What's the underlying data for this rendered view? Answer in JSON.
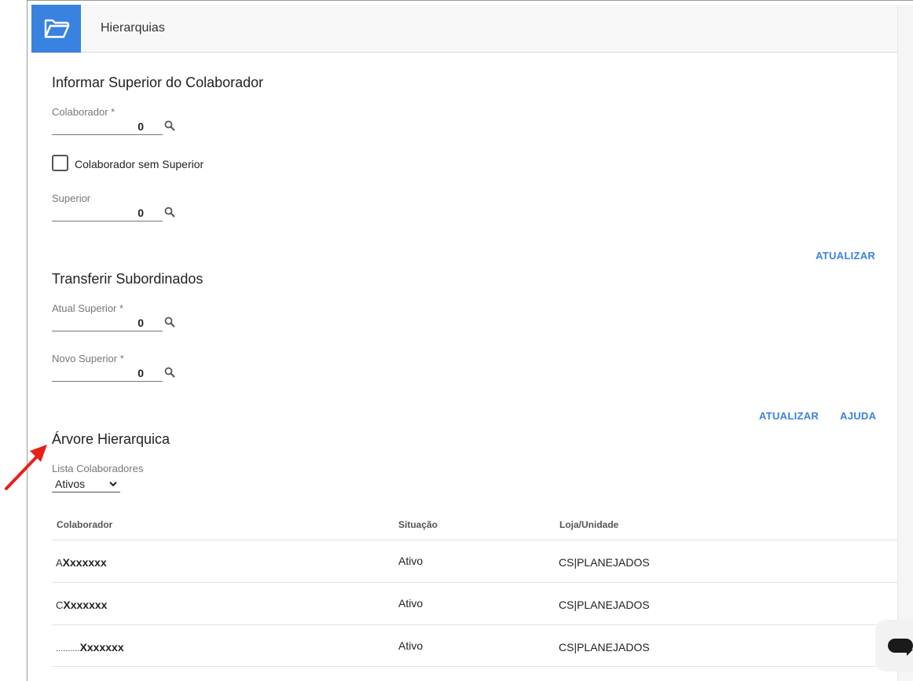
{
  "header": {
    "title": "Hierarquias",
    "icon": "folder-open-icon"
  },
  "section1": {
    "title": "Informar Superior do Colaborador",
    "colaborador": {
      "label": "Colaborador *",
      "value": "0"
    },
    "sem_superior_label": "Colaborador sem Superior",
    "superior": {
      "label": "Superior",
      "value": "0"
    },
    "update_label": "ATUALIZAR"
  },
  "section2": {
    "title": "Transferir Subordinados",
    "atual": {
      "label": "Atual Superior *",
      "value": "0"
    },
    "novo": {
      "label": "Novo Superior *",
      "value": "0"
    },
    "update_label": "ATUALIZAR",
    "help_label": "AJUDA"
  },
  "section3": {
    "title": "Árvore Hierarquica",
    "list_label": "Lista Colaboradores",
    "list_value": "Ativos",
    "columns": [
      "Colaborador",
      "Situação",
      "Loja/Unidade"
    ],
    "rows": [
      {
        "prefix": "A",
        "name": "Xxxxxxx",
        "status": "Ativo",
        "unit": "CS|PLANEJADOS"
      },
      {
        "prefix": "C",
        "name": "Xxxxxxx",
        "status": "Ativo",
        "unit": "CS|PLANEJADOS"
      },
      {
        "prefix": "..........",
        "name": "Xxxxxxx",
        "status": "Ativo",
        "unit": "CS|PLANEJADOS"
      }
    ]
  },
  "colors": {
    "accent": "#3a82e0",
    "annotation_arrow": "#e8201a"
  }
}
